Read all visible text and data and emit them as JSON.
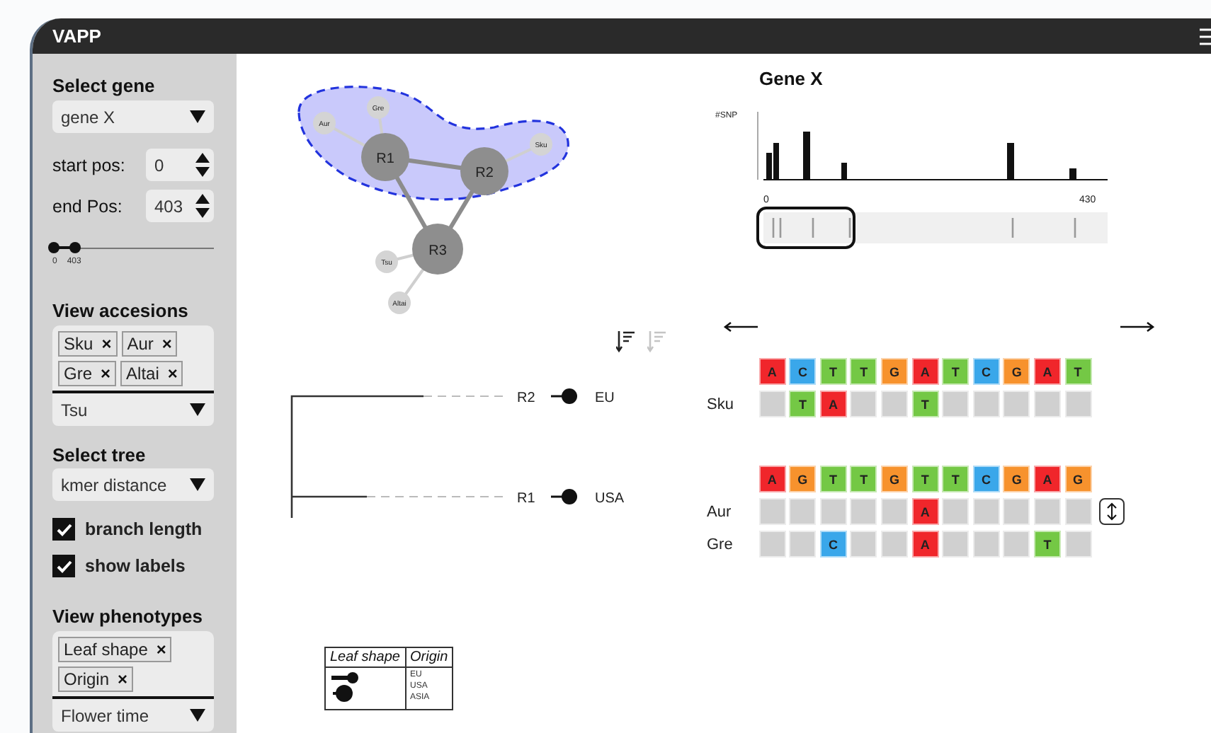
{
  "window": {
    "title": "VAPP"
  },
  "sidebar": {
    "gene": {
      "heading": "Select gene",
      "value": "gene X"
    },
    "start": {
      "label": "start pos:",
      "value": "0"
    },
    "end": {
      "label": "end Pos:",
      "value": "403"
    },
    "range": {
      "level": 0.13,
      "min_label": "0",
      "max_label": "403"
    },
    "accessions": {
      "heading": "View accesions",
      "tags": [
        "Sku",
        "Aur",
        "Gre",
        "Altai"
      ],
      "remove": "×",
      "dropdown": "Tsu"
    },
    "tree": {
      "heading": "Select tree",
      "value": "kmer distance"
    },
    "options": [
      {
        "label": "branch length",
        "checked": true
      },
      {
        "label": "show labels",
        "checked": true
      }
    ],
    "phenotypes": {
      "heading": "View phenotypes",
      "tags": [
        "Leaf shape",
        "Origin"
      ],
      "remove": "×",
      "dropdown": "Flower time"
    }
  },
  "network": {
    "highlighted": true,
    "nodes": [
      {
        "label": "Aur",
        "kind": "leaf"
      },
      {
        "label": "Gre",
        "kind": "leaf"
      },
      {
        "label": "R1",
        "kind": "hub"
      },
      {
        "label": "R2",
        "kind": "hub"
      },
      {
        "label": "Sku",
        "kind": "leaf"
      },
      {
        "label": "R3",
        "kind": "hub"
      },
      {
        "label": "Tsu",
        "kind": "leaf"
      },
      {
        "label": "Altai",
        "kind": "leaf"
      }
    ]
  },
  "sort_buttons": [
    {
      "disabled": false
    },
    {
      "disabled": true
    }
  ],
  "tree_view": {
    "leaves": [
      {
        "label": "R2",
        "origin": "EU"
      },
      {
        "label": "R1",
        "origin": "USA"
      }
    ]
  },
  "legend": {
    "columns": [
      "Leaf shape",
      "Origin"
    ],
    "origins": [
      "EU",
      "USA",
      "ASIA"
    ]
  },
  "gene_panel": {
    "title": "Gene X",
    "ylabel": "#SNP",
    "x_start": "0",
    "x_end": "430"
  },
  "alignment": {
    "groups": [
      {
        "expandable": false,
        "reference": [
          {
            "base": "A",
            "color": "#f0262b"
          },
          {
            "base": "C",
            "color": "#3aa7ea"
          },
          {
            "base": "T",
            "color": "#74c845"
          },
          {
            "base": "T",
            "color": "#74c845"
          },
          {
            "base": "G",
            "color": "#f7922d"
          },
          {
            "base": "A",
            "color": "#f0262b"
          },
          {
            "base": "T",
            "color": "#74c845"
          },
          {
            "base": "C",
            "color": "#3aa7ea"
          },
          {
            "base": "G",
            "color": "#f7922d"
          },
          {
            "base": "A",
            "color": "#f0262b"
          },
          {
            "base": "T",
            "color": "#74c845"
          }
        ],
        "rows": [
          {
            "name": "Sku",
            "cells": [
              {
                "kind": "same"
              },
              {
                "kind": "snp",
                "base": "T",
                "color": "#74c845"
              },
              {
                "kind": "snp",
                "base": "A",
                "color": "#f0262b"
              },
              {
                "kind": "same"
              },
              {
                "kind": "same"
              },
              {
                "kind": "snp",
                "base": "T",
                "color": "#74c845"
              },
              {
                "kind": "same"
              },
              {
                "kind": "same"
              },
              {
                "kind": "same"
              },
              {
                "kind": "same"
              },
              {
                "kind": "same"
              }
            ]
          }
        ]
      },
      {
        "expandable": true,
        "reference": [
          {
            "base": "A",
            "color": "#f0262b"
          },
          {
            "base": "G",
            "color": "#f7922d"
          },
          {
            "base": "T",
            "color": "#74c845"
          },
          {
            "base": "T",
            "color": "#74c845"
          },
          {
            "base": "G",
            "color": "#f7922d"
          },
          {
            "base": "T",
            "color": "#74c845"
          },
          {
            "base": "T",
            "color": "#74c845"
          },
          {
            "base": "C",
            "color": "#3aa7ea"
          },
          {
            "base": "G",
            "color": "#f7922d"
          },
          {
            "base": "A",
            "color": "#f0262b"
          },
          {
            "base": "G",
            "color": "#f7922d"
          }
        ],
        "rows": [
          {
            "name": "Aur",
            "cells": [
              {
                "kind": "same"
              },
              {
                "kind": "same"
              },
              {
                "kind": "same"
              },
              {
                "kind": "same"
              },
              {
                "kind": "same"
              },
              {
                "kind": "snp",
                "base": "A",
                "color": "#f0262b"
              },
              {
                "kind": "same"
              },
              {
                "kind": "same"
              },
              {
                "kind": "same"
              },
              {
                "kind": "same"
              },
              {
                "kind": "same"
              }
            ]
          },
          {
            "name": "Gre",
            "cells": [
              {
                "kind": "same"
              },
              {
                "kind": "same"
              },
              {
                "kind": "snp",
                "base": "C",
                "color": "#3aa7ea"
              },
              {
                "kind": "same"
              },
              {
                "kind": "same"
              },
              {
                "kind": "snp",
                "base": "A",
                "color": "#f0262b"
              },
              {
                "kind": "same"
              },
              {
                "kind": "same"
              },
              {
                "kind": "same"
              },
              {
                "kind": "snp",
                "base": "T",
                "color": "#74c845"
              },
              {
                "kind": "same"
              }
            ]
          }
        ]
      }
    ]
  }
}
